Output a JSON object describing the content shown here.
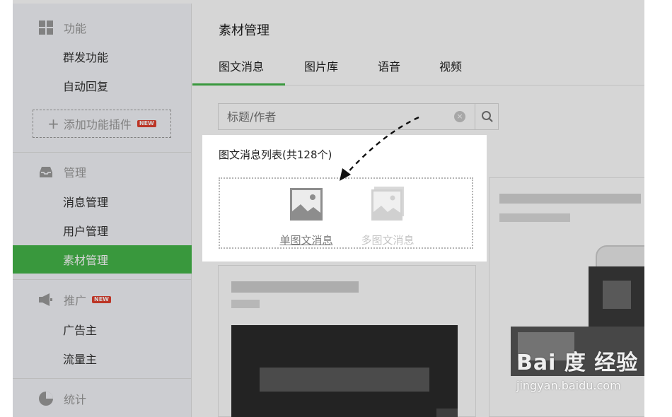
{
  "sidebar": {
    "sections": [
      {
        "title": "功能",
        "icon": "grid-icon",
        "items": [
          "群发功能",
          "自动回复"
        ]
      },
      {
        "title": "管理",
        "icon": "inbox-icon",
        "items": [
          "消息管理",
          "用户管理",
          "素材管理"
        ]
      },
      {
        "title": "推广",
        "icon": "megaphone-icon",
        "badge": "NEW",
        "items": [
          "广告主",
          "流量主"
        ]
      },
      {
        "title": "统计",
        "icon": "pie-chart-icon",
        "items": []
      }
    ],
    "add_plugin_label": "添加功能插件",
    "add_plugin_badge": "NEW",
    "active_item": "素材管理"
  },
  "main": {
    "title": "素材管理",
    "tabs": [
      "图文消息",
      "图片库",
      "语音",
      "视频"
    ],
    "active_tab": "图文消息",
    "search": {
      "placeholder": "标题/作者"
    },
    "list_title": "图文消息列表(共128个)",
    "create_options": [
      {
        "label": "单图文消息",
        "icon": "single-image-icon"
      },
      {
        "label": "多图文消息",
        "icon": "multi-image-icon"
      }
    ]
  },
  "watermark": {
    "logo": "Bai 度 经验",
    "url": "jingyan.baidu.com"
  },
  "colors": {
    "accent": "#44b549",
    "badge": "#e0402e",
    "sidebar_bg": "#f4f5f9"
  }
}
